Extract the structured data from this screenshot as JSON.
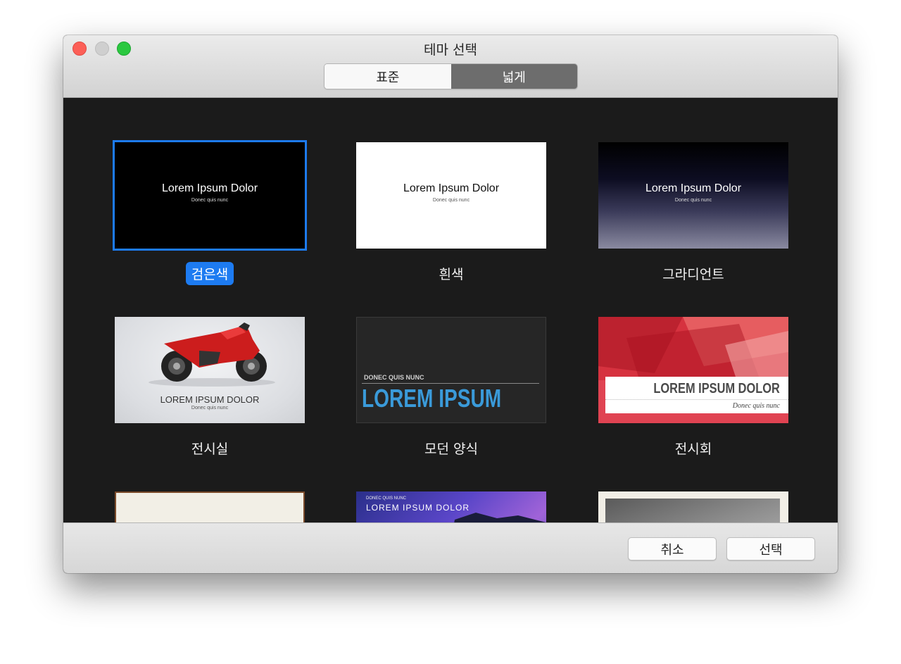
{
  "window": {
    "title": "테마 선택"
  },
  "segmented": {
    "standard": "표준",
    "wide": "넓게",
    "selected": "wide"
  },
  "themes": [
    {
      "name": "검은색",
      "preview_title": "Lorem Ipsum Dolor",
      "preview_subtitle": "Donec quis nunc",
      "selected": true
    },
    {
      "name": "흰색",
      "preview_title": "Lorem Ipsum Dolor",
      "preview_subtitle": "Donec quis nunc"
    },
    {
      "name": "그라디언트",
      "preview_title": "Lorem Ipsum Dolor",
      "preview_subtitle": "Donec quis nunc"
    },
    {
      "name": "전시실",
      "preview_title": "LOREM IPSUM DOLOR",
      "preview_subtitle": "Donec quis nunc"
    },
    {
      "name": "모던 양식",
      "preview_kicker": "DONEC QUIS NUNC",
      "preview_title": "LOREM IPSUM"
    },
    {
      "name": "전시회",
      "preview_title": "LOREM IPSUM DOLOR",
      "preview_subtitle": "Donec quis nunc"
    },
    {
      "name": ""
    },
    {
      "name": "",
      "preview_kicker": "DONEC QUIS NUNC",
      "preview_title": "LOREM IPSUM DOLOR"
    },
    {
      "name": ""
    }
  ],
  "footer": {
    "cancel": "취소",
    "choose": "선택"
  },
  "colors": {
    "accent": "#1d7bf1",
    "modern_title": "#3a9ad9",
    "background": "#1b1b1b"
  }
}
